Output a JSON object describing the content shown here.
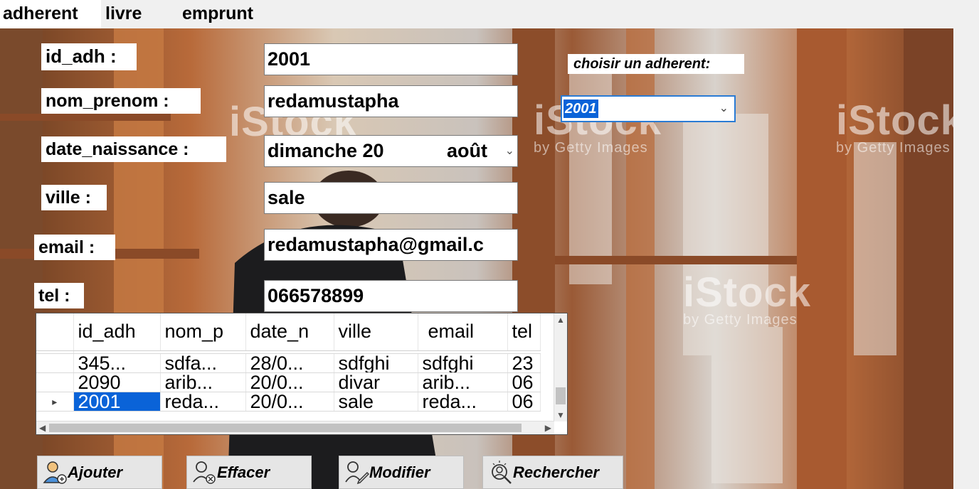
{
  "tabs": [
    {
      "label": "adherent"
    },
    {
      "label": "livre"
    },
    {
      "label": "emprunt"
    }
  ],
  "form": {
    "id_label": "id_adh :",
    "id_value": "2001",
    "nom_label": "nom_prenom :",
    "nom_value": "redamustapha",
    "date_label": "date_naissance :",
    "date_day": "dimanche 20",
    "date_month": "août",
    "ville_label": "ville :",
    "ville_value": "sale",
    "email_label": "email :",
    "email_value": "redamustapha@gmail.c",
    "tel_label": "tel :",
    "tel_value": "066578899"
  },
  "chooser": {
    "label": "choisir un adherent:",
    "selected": "2001"
  },
  "grid": {
    "headers": [
      "id_adh",
      "nom_p",
      "date_n",
      "ville",
      "email",
      "tel"
    ],
    "rows": [
      [
        "345...",
        "sdfa...",
        "28/0...",
        "sdfghi",
        "sdfghi",
        "23"
      ],
      [
        "2090",
        "arib...",
        "20/0...",
        "divar",
        "arib...",
        "06"
      ],
      [
        "2001",
        "reda...",
        "20/0...",
        "sale",
        "reda...",
        "06"
      ]
    ],
    "current_row_marker": "▸"
  },
  "buttons": {
    "add": "Ajouter",
    "clear": "Effacer",
    "edit": "Modifier",
    "search": "Rechercher"
  },
  "watermark": {
    "brand": "iStock",
    "sub": "by Getty Images"
  },
  "colors": {
    "selection": "#0a63d8",
    "focus_border": "#2a7bd4",
    "shelf_wood": "#a0522d"
  }
}
